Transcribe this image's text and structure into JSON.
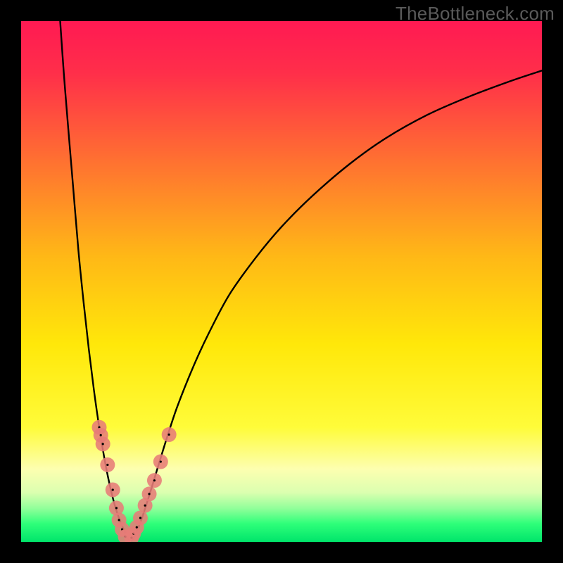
{
  "watermark": "TheBottleneck.com",
  "chart_data": {
    "type": "line",
    "title": "",
    "xlabel": "",
    "ylabel": "",
    "xlim": [
      0,
      100
    ],
    "ylim": [
      0,
      100
    ],
    "gradient_stops": [
      {
        "offset": 0.0,
        "color": "#ff1a53"
      },
      {
        "offset": 0.1,
        "color": "#ff2f4a"
      },
      {
        "offset": 0.25,
        "color": "#ff6a34"
      },
      {
        "offset": 0.45,
        "color": "#ffb817"
      },
      {
        "offset": 0.62,
        "color": "#ffe80a"
      },
      {
        "offset": 0.78,
        "color": "#fffc3a"
      },
      {
        "offset": 0.86,
        "color": "#fdffb0"
      },
      {
        "offset": 0.905,
        "color": "#dcffb0"
      },
      {
        "offset": 0.935,
        "color": "#93ff9b"
      },
      {
        "offset": 0.965,
        "color": "#2fff7a"
      },
      {
        "offset": 1.0,
        "color": "#00e56b"
      }
    ],
    "series": [
      {
        "name": "bottleneck-curve",
        "type": "line",
        "x_norm": [
          7.5,
          8.2,
          9.0,
          10.0,
          11.0,
          12.0,
          13.0,
          14.0,
          15.0,
          16.0,
          17.0,
          18.0,
          19.0,
          20.0,
          20.8,
          21.5,
          22.0,
          23.0,
          24.0,
          25.0,
          26.0,
          28.0,
          30.0,
          33.0,
          36.0,
          40.0,
          45.0,
          50.0,
          56.0,
          63.0,
          70.0,
          78.0,
          86.0,
          94.0,
          100.0
        ],
        "y_norm": [
          100.0,
          90.0,
          80.0,
          68.0,
          56.0,
          46.0,
          37.0,
          29.0,
          22.0,
          16.0,
          11.0,
          7.0,
          4.0,
          1.8,
          0.5,
          0.5,
          1.6,
          4.0,
          7.0,
          10.2,
          13.5,
          20.0,
          26.0,
          33.5,
          40.0,
          47.5,
          54.5,
          60.5,
          66.5,
          72.5,
          77.5,
          82.0,
          85.5,
          88.5,
          90.5
        ]
      },
      {
        "name": "dots-left",
        "type": "scatter",
        "color": "#e77c78",
        "x_norm": [
          15.0,
          15.3,
          15.7,
          16.6,
          17.6,
          18.3,
          18.8,
          19.4,
          20.0
        ],
        "y_norm": [
          22.0,
          20.5,
          18.8,
          14.8,
          10.0,
          6.5,
          4.2,
          2.4,
          1.0
        ]
      },
      {
        "name": "dots-right",
        "type": "scatter",
        "color": "#e77c78",
        "x_norm": [
          21.2,
          21.6,
          22.2,
          22.9,
          23.8,
          24.6,
          25.6,
          26.8,
          28.4
        ],
        "y_norm": [
          0.8,
          1.6,
          2.8,
          4.6,
          7.0,
          9.2,
          11.8,
          15.4,
          20.6
        ]
      }
    ]
  }
}
